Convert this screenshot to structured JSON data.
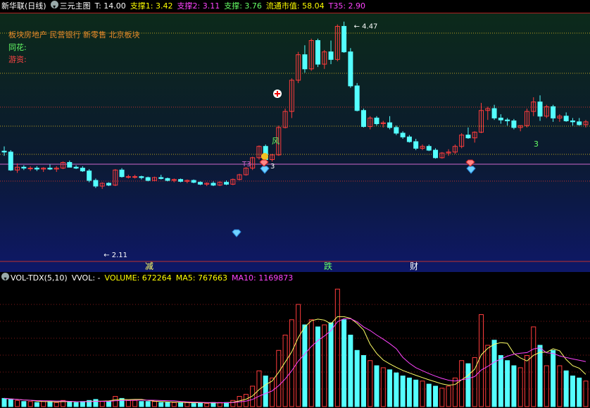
{
  "header": {
    "stock_name": "新华联(日线)",
    "indicator_name": "三元主图",
    "t_label": "T: 14.00",
    "support1": "支撑1: 3.42",
    "support2": "支撑2: 3.11",
    "support3": "支撑: 3.76",
    "market_cap": "流通市值: 58.04",
    "t35": "T35: 2.90"
  },
  "info": {
    "sector_line": "板块房地产      民营银行 新零售   北京板块",
    "tonghua": "同花:",
    "youzi": "游资:"
  },
  "annotations": {
    "high_price": "4.47",
    "low_price": "2.11",
    "t3_label": "T3",
    "t3_value": "3",
    "feng": "风",
    "three_right": "3",
    "bottom_chars": [
      "减",
      "跌",
      "财"
    ]
  },
  "vol_header": {
    "name": "VOL-TDX(5,10)",
    "vvol": "VVOL: -",
    "volume": "VOLUME: 672264",
    "ma5": "MA5: 767663",
    "ma10": "MA10: 1169873"
  },
  "colors": {
    "up": "#ff3c3c",
    "down": "#54ffff",
    "ma5": "#ffff66",
    "ma10": "#ff44ff",
    "header_white": "#ffffff",
    "header_yellow": "#ffff00",
    "header_magenta": "#ff44ff",
    "header_green": "#66ff66",
    "sector": "#e88a2a"
  },
  "chart_data": {
    "type": "candlestick",
    "title": "新华联(日线)",
    "price_range": [
      2.11,
      4.47
    ],
    "candles": [
      [
        3.13,
        3.18,
        3.08,
        3.12
      ],
      [
        3.12,
        3.14,
        2.92,
        2.93
      ],
      [
        2.93,
        3.0,
        2.9,
        2.96
      ],
      [
        2.96,
        2.98,
        2.93,
        2.95
      ],
      [
        2.95,
        2.97,
        2.92,
        2.95
      ],
      [
        2.95,
        2.97,
        2.92,
        2.94
      ],
      [
        2.94,
        2.96,
        2.91,
        2.95
      ],
      [
        2.95,
        2.99,
        2.93,
        2.94
      ],
      [
        2.94,
        2.97,
        2.91,
        2.95
      ],
      [
        2.95,
        3.02,
        2.94,
        3.01
      ],
      [
        3.01,
        3.03,
        2.96,
        2.96
      ],
      [
        2.96,
        2.98,
        2.94,
        2.95
      ],
      [
        2.95,
        2.97,
        2.91,
        2.92
      ],
      [
        2.92,
        2.94,
        2.8,
        2.82
      ],
      [
        2.82,
        2.84,
        2.74,
        2.76
      ],
      [
        2.76,
        2.8,
        2.73,
        2.79
      ],
      [
        2.79,
        2.8,
        2.76,
        2.77
      ],
      [
        2.77,
        2.94,
        2.76,
        2.93
      ],
      [
        2.93,
        2.95,
        2.85,
        2.86
      ],
      [
        2.86,
        2.88,
        2.84,
        2.86
      ],
      [
        2.86,
        2.88,
        2.84,
        2.86
      ],
      [
        2.86,
        2.87,
        2.83,
        2.85
      ],
      [
        2.85,
        2.86,
        2.81,
        2.82
      ],
      [
        2.82,
        2.86,
        2.81,
        2.85
      ],
      [
        2.85,
        2.88,
        2.83,
        2.84
      ],
      [
        2.84,
        2.85,
        2.81,
        2.82
      ],
      [
        2.82,
        2.84,
        2.8,
        2.83
      ],
      [
        2.83,
        2.84,
        2.8,
        2.81
      ],
      [
        2.81,
        2.83,
        2.79,
        2.82
      ],
      [
        2.82,
        2.83,
        2.79,
        2.8
      ],
      [
        2.8,
        2.81,
        2.77,
        2.78
      ],
      [
        2.78,
        2.8,
        2.76,
        2.79
      ],
      [
        2.79,
        2.81,
        2.76,
        2.77
      ],
      [
        2.77,
        2.81,
        2.76,
        2.8
      ],
      [
        2.8,
        2.82,
        2.77,
        2.78
      ],
      [
        2.78,
        2.84,
        2.77,
        2.83
      ],
      [
        2.83,
        2.89,
        2.82,
        2.88
      ],
      [
        2.88,
        2.96,
        2.87,
        2.95
      ],
      [
        2.95,
        3.07,
        2.93,
        3.06
      ],
      [
        3.06,
        3.19,
        3.04,
        3.18
      ],
      [
        3.18,
        3.2,
        3.02,
        3.04
      ],
      [
        3.04,
        3.1,
        3.02,
        3.09
      ],
      [
        3.09,
        3.4,
        3.08,
        3.38
      ],
      [
        3.38,
        3.58,
        3.37,
        3.55
      ],
      [
        3.55,
        3.9,
        3.48,
        3.88
      ],
      [
        3.88,
        4.18,
        3.85,
        4.15
      ],
      [
        4.15,
        4.25,
        3.96,
        4.0
      ],
      [
        4.0,
        4.32,
        3.98,
        4.3
      ],
      [
        4.3,
        4.32,
        4.02,
        4.05
      ],
      [
        4.05,
        4.2,
        4.0,
        4.18
      ],
      [
        4.18,
        4.3,
        4.05,
        4.1
      ],
      [
        4.1,
        4.47,
        4.08,
        4.45
      ],
      [
        4.45,
        4.5,
        4.17,
        4.18
      ],
      [
        4.18,
        4.22,
        3.8,
        3.82
      ],
      [
        3.82,
        3.85,
        3.55,
        3.56
      ],
      [
        3.56,
        3.58,
        3.38,
        3.39
      ],
      [
        3.39,
        3.5,
        3.36,
        3.48
      ],
      [
        3.48,
        3.5,
        3.4,
        3.42
      ],
      [
        3.42,
        3.45,
        3.38,
        3.43
      ],
      [
        3.43,
        3.5,
        3.36,
        3.38
      ],
      [
        3.38,
        3.4,
        3.3,
        3.32
      ],
      [
        3.32,
        3.34,
        3.26,
        3.28
      ],
      [
        3.28,
        3.3,
        3.22,
        3.23
      ],
      [
        3.23,
        3.26,
        3.14,
        3.16
      ],
      [
        3.16,
        3.2,
        3.14,
        3.18
      ],
      [
        3.18,
        3.2,
        3.13,
        3.14
      ],
      [
        3.14,
        3.16,
        3.05,
        3.06
      ],
      [
        3.06,
        3.12,
        3.05,
        3.11
      ],
      [
        3.11,
        3.15,
        3.08,
        3.12
      ],
      [
        3.12,
        3.2,
        3.1,
        3.18
      ],
      [
        3.18,
        3.32,
        3.16,
        3.3
      ],
      [
        3.3,
        3.38,
        3.26,
        3.27
      ],
      [
        3.27,
        3.34,
        3.22,
        3.33
      ],
      [
        3.33,
        3.64,
        3.32,
        3.56
      ],
      [
        3.56,
        3.6,
        3.46,
        3.58
      ],
      [
        3.58,
        3.62,
        3.46,
        3.48
      ],
      [
        3.48,
        3.52,
        3.42,
        3.46
      ],
      [
        3.46,
        3.48,
        3.4,
        3.45
      ],
      [
        3.45,
        3.47,
        3.36,
        3.38
      ],
      [
        3.38,
        3.4,
        3.34,
        3.4
      ],
      [
        3.4,
        3.58,
        3.38,
        3.55
      ],
      [
        3.55,
        3.7,
        3.5,
        3.65
      ],
      [
        3.65,
        3.72,
        3.45,
        3.5
      ],
      [
        3.5,
        3.62,
        3.48,
        3.6
      ],
      [
        3.6,
        3.62,
        3.44,
        3.48
      ],
      [
        3.48,
        3.52,
        3.44,
        3.5
      ],
      [
        3.5,
        3.54,
        3.44,
        3.45
      ],
      [
        3.45,
        3.48,
        3.4,
        3.44
      ],
      [
        3.44,
        3.48,
        3.4,
        3.41
      ],
      [
        3.41,
        3.46,
        3.38,
        3.44
      ]
    ],
    "volume": [
      0.08,
      0.07,
      0.06,
      0.05,
      0.05,
      0.04,
      0.05,
      0.05,
      0.04,
      0.06,
      0.05,
      0.04,
      0.05,
      0.06,
      0.07,
      0.05,
      0.05,
      0.1,
      0.08,
      0.06,
      0.06,
      0.05,
      0.05,
      0.05,
      0.04,
      0.04,
      0.04,
      0.04,
      0.04,
      0.03,
      0.04,
      0.03,
      0.04,
      0.04,
      0.04,
      0.06,
      0.1,
      0.12,
      0.2,
      0.35,
      0.3,
      0.28,
      0.55,
      0.7,
      0.85,
      1.0,
      0.8,
      0.85,
      0.78,
      0.8,
      0.82,
      1.15,
      0.85,
      0.7,
      0.55,
      0.5,
      0.45,
      0.4,
      0.38,
      0.36,
      0.33,
      0.3,
      0.28,
      0.26,
      0.25,
      0.22,
      0.2,
      0.18,
      0.2,
      0.28,
      0.45,
      0.42,
      0.48,
      0.9,
      0.6,
      0.65,
      0.5,
      0.45,
      0.4,
      0.38,
      0.5,
      0.78,
      0.6,
      0.4,
      0.55,
      0.4,
      0.35,
      0.3,
      0.28,
      0.25
    ],
    "volume_label": "VOLUME: 672264"
  }
}
